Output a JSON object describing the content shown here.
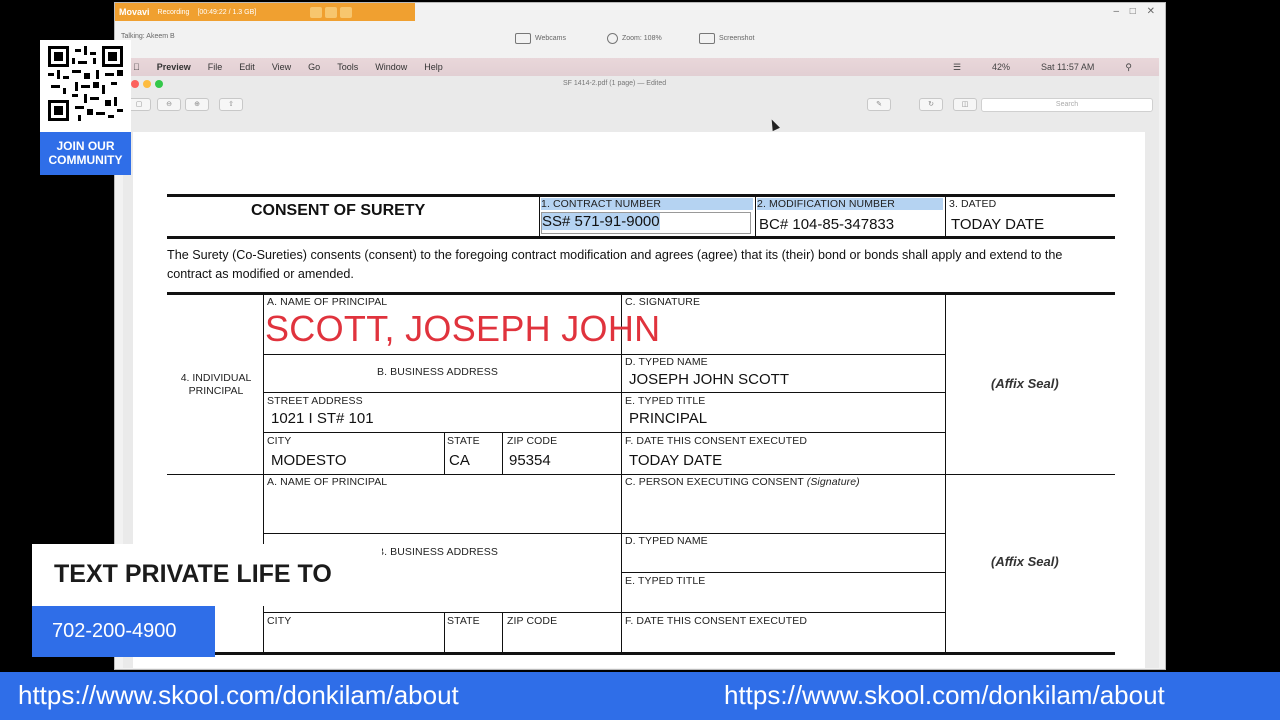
{
  "recorder": {
    "app_name": "Movavi",
    "status": "Recording",
    "timer": "[00:49:22 / 1.3 GB]",
    "talking": "Talking: Akeem B",
    "webcams": "Webcams",
    "zoom": "Zoom: 108%",
    "screenshot": "Screenshot",
    "window_controls": "– □ ✕"
  },
  "menubar": {
    "apple": "",
    "items": [
      "Preview",
      "File",
      "Edit",
      "View",
      "Go",
      "Tools",
      "Window",
      "Help"
    ],
    "battery": "42%",
    "clock": "Sat 11:57 AM"
  },
  "preview": {
    "doc_title": "SF 1414-2.pdf (1 page) — Edited",
    "search_placeholder": "Search"
  },
  "form": {
    "title": "CONSENT OF SURETY",
    "contract_label": "1. CONTRACT NUMBER",
    "contract_value": "SS#  571-91-9000",
    "modification_label": "2. MODIFICATION NUMBER",
    "modification_value": "BC# 104-85-347833",
    "dated_label": "3. DATED",
    "dated_value": "TODAY DATE",
    "paragraph": "The Surety (Co-Sureties) consents (consent) to the foregoing contract modification and agrees (agree) that its (their) bond or bonds shall apply and extend to the contract as modified or amended.",
    "individual_section": "4. INDIVIDUAL PRINCIPAL",
    "name_of_principal_label": "a. NAME OF PRINCIPAL",
    "name_of_principal_value": "SCOTT, JOSEPH JOHN",
    "signature_label": "c. SIGNATURE",
    "business_address_label": "b. BUSINESS ADDRESS",
    "typed_name_label": "d. TYPED NAME",
    "typed_name_value": "JOSEPH JOHN SCOTT",
    "street_label": "STREET ADDRESS",
    "street_value": "1021 I ST# 101",
    "typed_title_label": "e. TYPED TITLE",
    "typed_title_value": "PRINCIPAL",
    "city_label": "CITY",
    "city_value": "MODESTO",
    "state_label": "STATE",
    "state_value": "CA",
    "zip_label": "ZIP CODE",
    "zip_value": "95354",
    "date_executed_label": "f. DATE THIS CONSENT EXECUTED",
    "date_executed_value": "TODAY DATE",
    "affix_seal": "(Affix Seal)",
    "corp_name_label": "a. NAME OF PRINCIPAL",
    "person_executing_label": "c. PERSON EXECUTING CONSENT",
    "person_executing_sig": "(Signature)",
    "corp_business_label": "b. BUSINESS ADDRESS",
    "corp_typed_name_label": "d. TYPED NAME",
    "corp_typed_title_label": "e. TYPED TITLE",
    "corp_city_label": "CITY",
    "corp_state_label": "STATE",
    "corp_zip_label": "ZIP CODE",
    "corp_date_label": "f. DATE THIS CONSENT EXECUTED",
    "corp_affix_seal": "(Affix Seal)"
  },
  "overlay": {
    "qr_caption": "JOIN OUR COMMUNITY",
    "promo": "TEXT PRIVATE LIFE TO",
    "phone": "702-200-4900",
    "url_left": "https://www.skool.com/donkilam/about",
    "url_right": "https://www.skool.com/donkilam/about"
  },
  "colors": {
    "accent": "#2f6ee8",
    "name_red": "#e0333d",
    "selection": "#b5d3f2",
    "recorder_orange": "#f0a030"
  }
}
